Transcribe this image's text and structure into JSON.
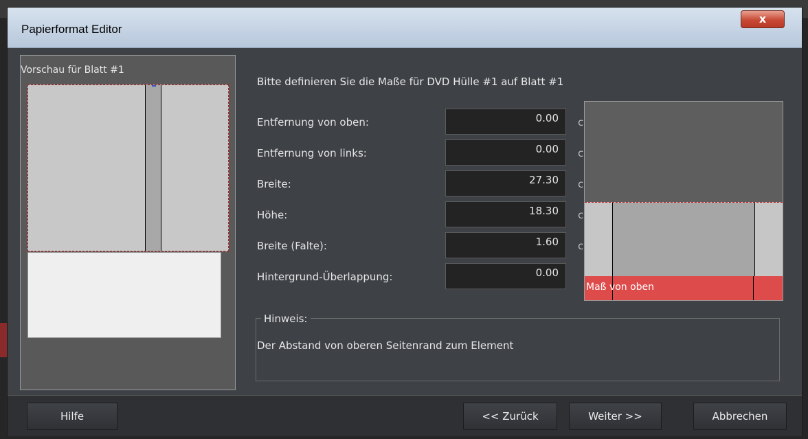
{
  "window": {
    "title": "Papierformat Editor",
    "close_symbol": "x"
  },
  "preview": {
    "label": "Vorschau für Blatt #1"
  },
  "instruction": "Bitte definieren Sie die Maße für DVD Hülle #1 auf Blatt #1",
  "fields": [
    {
      "label": "Entfernung von oben:",
      "value": "0.00"
    },
    {
      "label": "Entfernung von links:",
      "value": "0.00"
    },
    {
      "label": "Breite:",
      "value": "27.30"
    },
    {
      "label": "Höhe:",
      "value": "18.30"
    },
    {
      "label": "Breite (Falte):",
      "value": "1.60"
    },
    {
      "label": "Hintergrund-Überlappung:",
      "value": "0.00"
    }
  ],
  "unit_glyph": "c",
  "diagram": {
    "label": "Maß von oben",
    "highlight_color": "#de4b4b"
  },
  "hint": {
    "title": "Hinweis:",
    "text": "Der Abstand von oberen Seitenrand zum Element"
  },
  "buttons": {
    "help": "Hilfe",
    "back": "<< Zurück",
    "next": "Weiter >>",
    "cancel": "Abbrechen"
  },
  "colors": {
    "accent_red": "#c0181c",
    "fold_marker_blue": "#3a50c8"
  }
}
